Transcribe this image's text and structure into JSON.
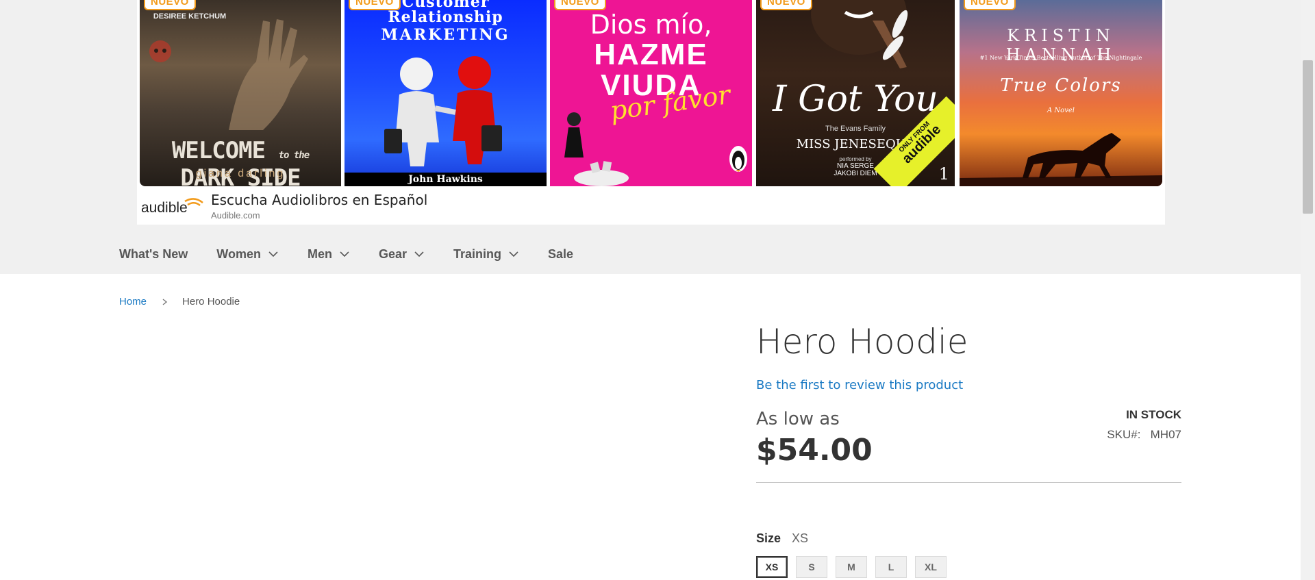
{
  "ad": {
    "badge": "NUEVO",
    "books": [
      {
        "author": "DESIREE KETCHUM",
        "title_top": "WELCOME",
        "title_mid": "to the",
        "title_bottom": "DARK SIDE",
        "subtitle": "giana darling"
      },
      {
        "title_line1": "Customer",
        "title_line2": "Relationship",
        "title_line3": "MARKETING",
        "author": "John Hawkins"
      },
      {
        "line1": "Dios mío,",
        "line2": "HAZME",
        "line3": "VIUDA",
        "line4": "por favor"
      },
      {
        "title": "I Got You",
        "series": "The Evans Family",
        "author": "MISS JENESEQUA",
        "performed_by": "performed by",
        "narrators": "NIA SERGE\nJAKOBI DIEM",
        "ribbon_top": "ONLY FROM",
        "ribbon_brand": "audible",
        "number": "1"
      },
      {
        "author": "KRISTIN HANNAH",
        "tagline": "#1 New York Times Bestselling Author of The Nightingale",
        "title": "True Colors",
        "subtitle": "A Novel"
      }
    ],
    "brand": "audible",
    "headline": "Escucha Audiolibros en Español",
    "url": "Audible.com"
  },
  "nav": {
    "items": [
      {
        "label": "What's New",
        "has_dropdown": false
      },
      {
        "label": "Women",
        "has_dropdown": true
      },
      {
        "label": "Men",
        "has_dropdown": true
      },
      {
        "label": "Gear",
        "has_dropdown": true
      },
      {
        "label": "Training",
        "has_dropdown": true
      },
      {
        "label": "Sale",
        "has_dropdown": false
      }
    ]
  },
  "breadcrumb": {
    "home": "Home",
    "current": "Hero Hoodie"
  },
  "product": {
    "title": "Hero Hoodie",
    "review_link": "Be the first to review this product",
    "price_label": "As low as",
    "price": "$54.00",
    "stock": "IN STOCK",
    "sku_label": "SKU#:",
    "sku": "MH07",
    "size_label": "Size",
    "size_selected": "XS",
    "sizes": [
      "XS",
      "S",
      "M",
      "L",
      "XL"
    ]
  },
  "colors": {
    "link": "#1979c3",
    "accent_badge": "#f29b1c",
    "band": "#f0f0f0"
  }
}
